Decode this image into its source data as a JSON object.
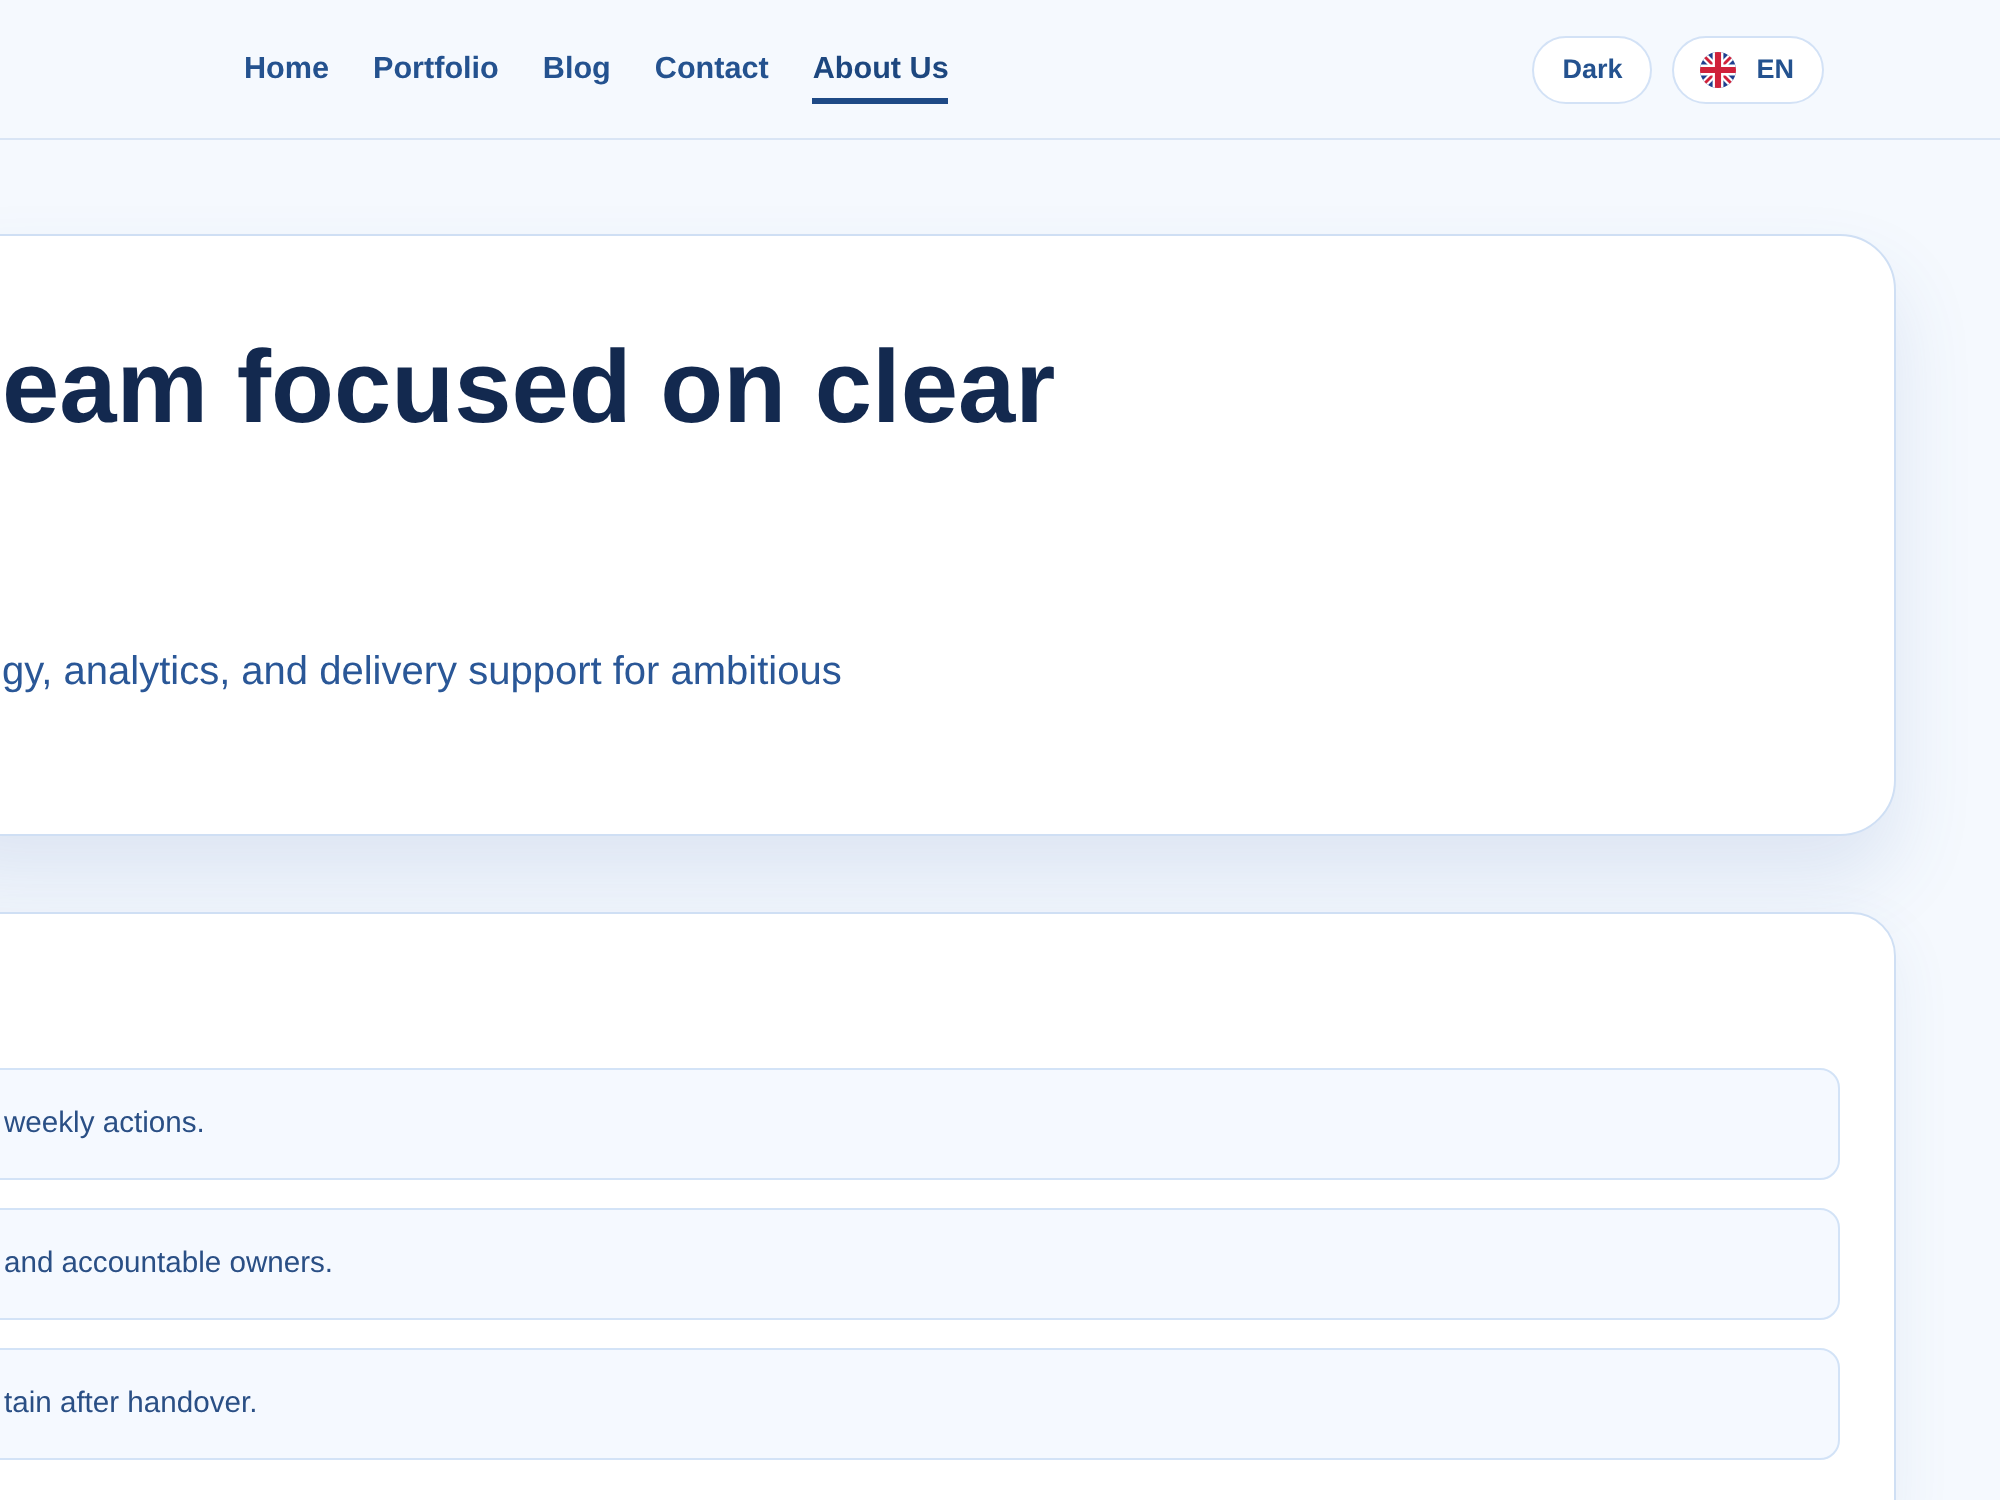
{
  "nav": {
    "links": [
      {
        "label": "Home",
        "selected": false
      },
      {
        "label": "Portfolio",
        "selected": false
      },
      {
        "label": "Blog",
        "selected": false
      },
      {
        "label": "Contact",
        "selected": false
      },
      {
        "label": "About Us",
        "selected": true
      }
    ]
  },
  "actions": {
    "theme_button": "Dark",
    "language_button": "EN"
  },
  "hero": {
    "heading": "eam focused on clear",
    "text": "gy, analytics, and delivery support for ambitious"
  },
  "list": {
    "items": [
      "weekly actions.",
      "and accountable owners.",
      "tain after handover."
    ]
  }
}
